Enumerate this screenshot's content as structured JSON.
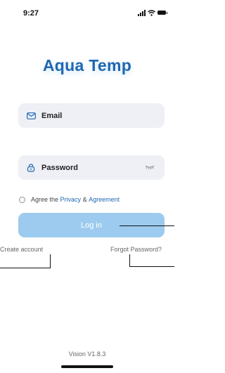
{
  "status_bar": {
    "time": "9:27"
  },
  "brand": {
    "logo_text": "Aqua Temp"
  },
  "form": {
    "email_label": "Email",
    "password_label": "Password",
    "email_icon": "mail-icon",
    "password_icon": "lock-icon",
    "toggle_icon": "eye-closed-icon"
  },
  "agreement": {
    "prefix": "Agree the",
    "privacy_link": "Privacy",
    "connector": "&",
    "agreement_link": "Agreement"
  },
  "actions": {
    "login_label": "Log in",
    "create_account": "Create account",
    "forgot_password": "Forgot Password?"
  },
  "footer": {
    "version": "Vision V1.8.3"
  },
  "colors": {
    "brand": "#1f67b1",
    "login_button": "#9ccbef",
    "field_background": "#eef0f6"
  }
}
